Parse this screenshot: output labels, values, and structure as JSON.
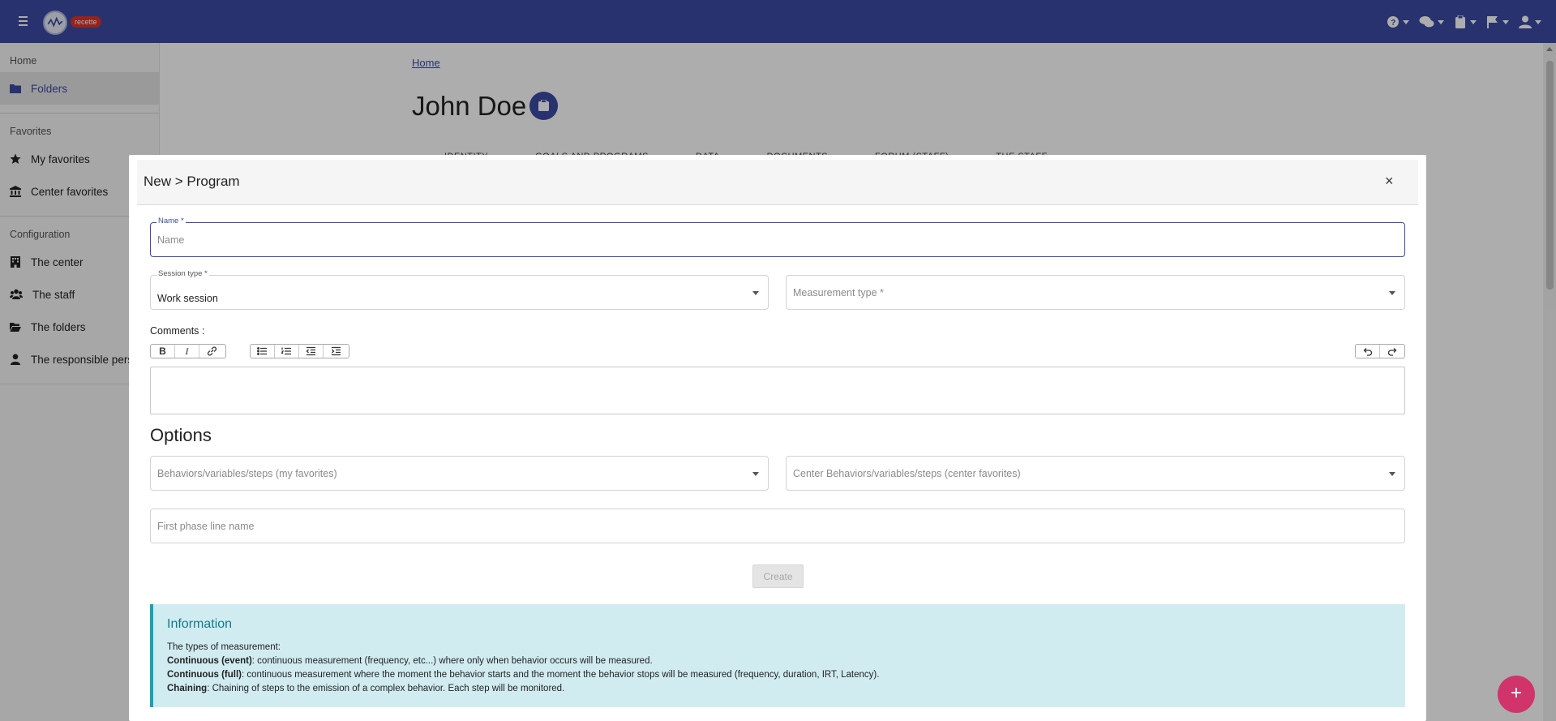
{
  "topbar": {
    "env_badge": "recette"
  },
  "sidebar": {
    "home_label": "Home",
    "folders_label": "Folders",
    "favorites_heading": "Favorites",
    "my_favorites": "My favorites",
    "center_favorites": "Center favorites",
    "configuration_heading": "Configuration",
    "the_center": "The center",
    "the_staff": "The staff",
    "the_folders": "The folders",
    "responsible_persons": "The responsible pers"
  },
  "page": {
    "breadcrumb": "Home",
    "title": "John Doe",
    "tabs": [
      "IDENTITY",
      "GOALS AND PROGRAMS",
      "DATA",
      "DOCUMENTS",
      "FORUM (STAFF)",
      "THE STAFF"
    ]
  },
  "modal": {
    "title": "New > Program",
    "close": "×",
    "name_label": "Name *",
    "name_placeholder": "Name",
    "session_type_label": "Session type *",
    "session_type_value": "Work session",
    "measurement_type_placeholder": "Measurement type *",
    "comments_label": "Comments :",
    "toolbar": {
      "bold": "B",
      "italic": "I"
    },
    "options_title": "Options",
    "behaviors_my_favorites": "Behaviors/variables/steps (my favorites)",
    "behaviors_center_favorites": "Center Behaviors/variables/steps (center favorites)",
    "first_phase_placeholder": "First phase line name",
    "create_button": "Create",
    "info": {
      "title": "Information",
      "intro": "The types of measurement:",
      "line1_bold": "Continuous (event)",
      "line1_text": ": continuous measurement (frequency, etc...) where only when behavior occurs will be measured.",
      "line2_bold": "Continuous (full)",
      "line2_text": ": continuous measurement where the moment the behavior starts and the moment the behavior stops will be measured (frequency, duration, IRT, Latency).",
      "line3_bold": "Chaining",
      "line3_text": ": Chaining of steps to the emission of a complex behavior. Each step will be monitored."
    }
  },
  "fab": "+",
  "colors": {
    "primary": "#3c4ba4",
    "fab": "#d0346a",
    "info_bg": "#d1ecf1",
    "badge": "#d9342b"
  }
}
